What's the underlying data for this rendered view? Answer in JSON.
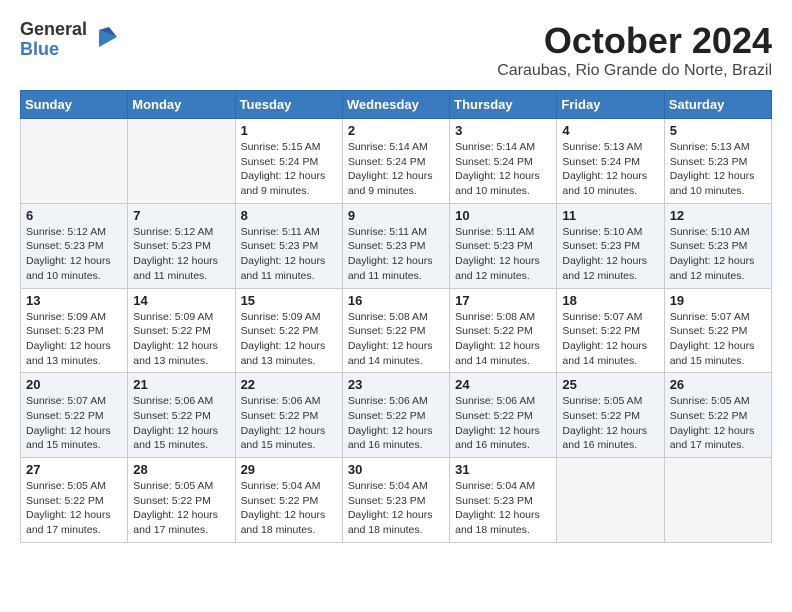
{
  "logo": {
    "general": "General",
    "blue": "Blue"
  },
  "title": "October 2024",
  "subtitle": "Caraubas, Rio Grande do Norte, Brazil",
  "days_of_week": [
    "Sunday",
    "Monday",
    "Tuesday",
    "Wednesday",
    "Thursday",
    "Friday",
    "Saturday"
  ],
  "weeks": [
    [
      {
        "day": "",
        "info": ""
      },
      {
        "day": "",
        "info": ""
      },
      {
        "day": "1",
        "info": "Sunrise: 5:15 AM\nSunset: 5:24 PM\nDaylight: 12 hours and 9 minutes."
      },
      {
        "day": "2",
        "info": "Sunrise: 5:14 AM\nSunset: 5:24 PM\nDaylight: 12 hours and 9 minutes."
      },
      {
        "day": "3",
        "info": "Sunrise: 5:14 AM\nSunset: 5:24 PM\nDaylight: 12 hours and 10 minutes."
      },
      {
        "day": "4",
        "info": "Sunrise: 5:13 AM\nSunset: 5:24 PM\nDaylight: 12 hours and 10 minutes."
      },
      {
        "day": "5",
        "info": "Sunrise: 5:13 AM\nSunset: 5:23 PM\nDaylight: 12 hours and 10 minutes."
      }
    ],
    [
      {
        "day": "6",
        "info": "Sunrise: 5:12 AM\nSunset: 5:23 PM\nDaylight: 12 hours and 10 minutes."
      },
      {
        "day": "7",
        "info": "Sunrise: 5:12 AM\nSunset: 5:23 PM\nDaylight: 12 hours and 11 minutes."
      },
      {
        "day": "8",
        "info": "Sunrise: 5:11 AM\nSunset: 5:23 PM\nDaylight: 12 hours and 11 minutes."
      },
      {
        "day": "9",
        "info": "Sunrise: 5:11 AM\nSunset: 5:23 PM\nDaylight: 12 hours and 11 minutes."
      },
      {
        "day": "10",
        "info": "Sunrise: 5:11 AM\nSunset: 5:23 PM\nDaylight: 12 hours and 12 minutes."
      },
      {
        "day": "11",
        "info": "Sunrise: 5:10 AM\nSunset: 5:23 PM\nDaylight: 12 hours and 12 minutes."
      },
      {
        "day": "12",
        "info": "Sunrise: 5:10 AM\nSunset: 5:23 PM\nDaylight: 12 hours and 12 minutes."
      }
    ],
    [
      {
        "day": "13",
        "info": "Sunrise: 5:09 AM\nSunset: 5:23 PM\nDaylight: 12 hours and 13 minutes."
      },
      {
        "day": "14",
        "info": "Sunrise: 5:09 AM\nSunset: 5:22 PM\nDaylight: 12 hours and 13 minutes."
      },
      {
        "day": "15",
        "info": "Sunrise: 5:09 AM\nSunset: 5:22 PM\nDaylight: 12 hours and 13 minutes."
      },
      {
        "day": "16",
        "info": "Sunrise: 5:08 AM\nSunset: 5:22 PM\nDaylight: 12 hours and 14 minutes."
      },
      {
        "day": "17",
        "info": "Sunrise: 5:08 AM\nSunset: 5:22 PM\nDaylight: 12 hours and 14 minutes."
      },
      {
        "day": "18",
        "info": "Sunrise: 5:07 AM\nSunset: 5:22 PM\nDaylight: 12 hours and 14 minutes."
      },
      {
        "day": "19",
        "info": "Sunrise: 5:07 AM\nSunset: 5:22 PM\nDaylight: 12 hours and 15 minutes."
      }
    ],
    [
      {
        "day": "20",
        "info": "Sunrise: 5:07 AM\nSunset: 5:22 PM\nDaylight: 12 hours and 15 minutes."
      },
      {
        "day": "21",
        "info": "Sunrise: 5:06 AM\nSunset: 5:22 PM\nDaylight: 12 hours and 15 minutes."
      },
      {
        "day": "22",
        "info": "Sunrise: 5:06 AM\nSunset: 5:22 PM\nDaylight: 12 hours and 15 minutes."
      },
      {
        "day": "23",
        "info": "Sunrise: 5:06 AM\nSunset: 5:22 PM\nDaylight: 12 hours and 16 minutes."
      },
      {
        "day": "24",
        "info": "Sunrise: 5:06 AM\nSunset: 5:22 PM\nDaylight: 12 hours and 16 minutes."
      },
      {
        "day": "25",
        "info": "Sunrise: 5:05 AM\nSunset: 5:22 PM\nDaylight: 12 hours and 16 minutes."
      },
      {
        "day": "26",
        "info": "Sunrise: 5:05 AM\nSunset: 5:22 PM\nDaylight: 12 hours and 17 minutes."
      }
    ],
    [
      {
        "day": "27",
        "info": "Sunrise: 5:05 AM\nSunset: 5:22 PM\nDaylight: 12 hours and 17 minutes."
      },
      {
        "day": "28",
        "info": "Sunrise: 5:05 AM\nSunset: 5:22 PM\nDaylight: 12 hours and 17 minutes."
      },
      {
        "day": "29",
        "info": "Sunrise: 5:04 AM\nSunset: 5:22 PM\nDaylight: 12 hours and 18 minutes."
      },
      {
        "day": "30",
        "info": "Sunrise: 5:04 AM\nSunset: 5:23 PM\nDaylight: 12 hours and 18 minutes."
      },
      {
        "day": "31",
        "info": "Sunrise: 5:04 AM\nSunset: 5:23 PM\nDaylight: 12 hours and 18 minutes."
      },
      {
        "day": "",
        "info": ""
      },
      {
        "day": "",
        "info": ""
      }
    ]
  ]
}
